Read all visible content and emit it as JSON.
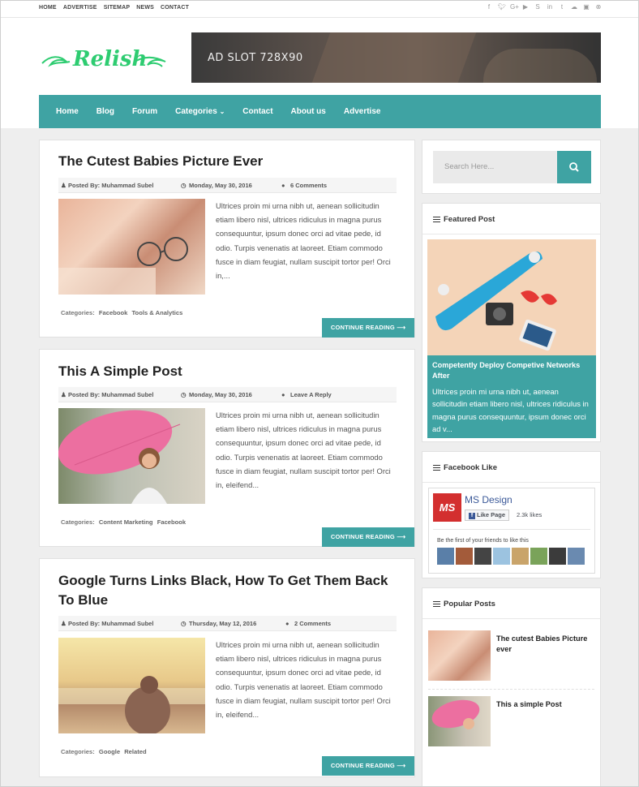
{
  "topbar": {
    "links": [
      "HOME",
      "ADVERTISE",
      "SITEMAP",
      "NEWS",
      "CONTACT"
    ],
    "social_icons": [
      "facebook-icon",
      "twitter-icon",
      "google-plus-icon",
      "youtube-icon",
      "skype-icon",
      "linkedin-icon",
      "tumblr-icon",
      "soundcloud-icon",
      "instagram-icon",
      "pinterest-icon"
    ]
  },
  "header": {
    "logo_text": "Relish",
    "ad_text": "AD SLOT 728X90"
  },
  "nav": {
    "items": [
      "Home",
      "Blog",
      "Forum",
      "Categories",
      "Contact",
      "About us",
      "Advertise"
    ]
  },
  "posts": [
    {
      "title": "The Cutest Babies Picture Ever",
      "author": "Posted By: Muhammad Subel",
      "date": "Monday, May 30, 2016",
      "comments": "6 Comments",
      "excerpt": "Ultrices proin mi urna nibh ut, aenean sollicitudin etiam libero nisl, ultrices ridiculus in magna purus consequuntur, ipsum donec orci ad vitae pede, id odio. Turpis venenatis at laoreet. Etiam commodo fusce in diam feugiat, nullam suscipit tortor per! Orci in,...",
      "categories_label": "Categories:",
      "categories": [
        "Facebook",
        "Tools & Analytics"
      ],
      "button": "CONTINUE READING"
    },
    {
      "title": "This A Simple Post",
      "author": "Posted By: Muhammad Subel",
      "date": "Monday, May 30, 2016",
      "comments": "Leave A Reply",
      "excerpt": "Ultrices proin mi urna nibh ut, aenean sollicitudin etiam libero nisl, ultrices ridiculus in magna purus consequuntur, ipsum donec orci ad vitae pede, id odio. Turpis venenatis at laoreet. Etiam commodo fusce in diam feugiat, nullam suscipit tortor per! Orci in, eleifend...",
      "categories_label": "Categories:",
      "categories": [
        "Content Marketing",
        "Facebook"
      ],
      "button": "CONTINUE READING"
    },
    {
      "title": "Google Turns Links Black, How To Get Them Back To Blue",
      "author": "Posted By: Muhammad Subel",
      "date": "Thursday, May 12, 2016",
      "comments": "2 Comments",
      "excerpt": "Ultrices proin mi urna nibh ut, aenean sollicitudin etiam libero nisl, ultrices ridiculus in magna purus consequuntur, ipsum donec orci ad vitae pede, id odio. Turpis venenatis at laoreet. Etiam commodo fusce in diam feugiat, nullam suscipit tortor per! Orci in, eleifend...",
      "categories_label": "Categories:",
      "categories": [
        "Google",
        "Related"
      ],
      "button": "CONTINUE READING"
    }
  ],
  "sidebar": {
    "search": {
      "placeholder": "Search Here..."
    },
    "featured": {
      "title": "Featured Post",
      "post_title": "Competently Deploy Competive Networks After",
      "post_text": "Ultrices proin mi urna nibh ut, aenean sollicitudin etiam libero nisl, ultrices ridiculus in magna purus consequuntur, ipsum donec orci ad v..."
    },
    "facebook": {
      "title": "Facebook Like",
      "logo": "MS",
      "page_name": "MS Design",
      "like_label": "Like Page",
      "likes": "2.3k likes",
      "friends_text": "Be the first of your friends to like this"
    },
    "popular": {
      "title": "Popular Posts",
      "items": [
        "The cutest Babies Picture ever",
        "This a simple Post"
      ]
    }
  },
  "colors": {
    "accent": "#3fa3a3",
    "logo": "#2ecc71",
    "facebook": "#3b5998"
  }
}
